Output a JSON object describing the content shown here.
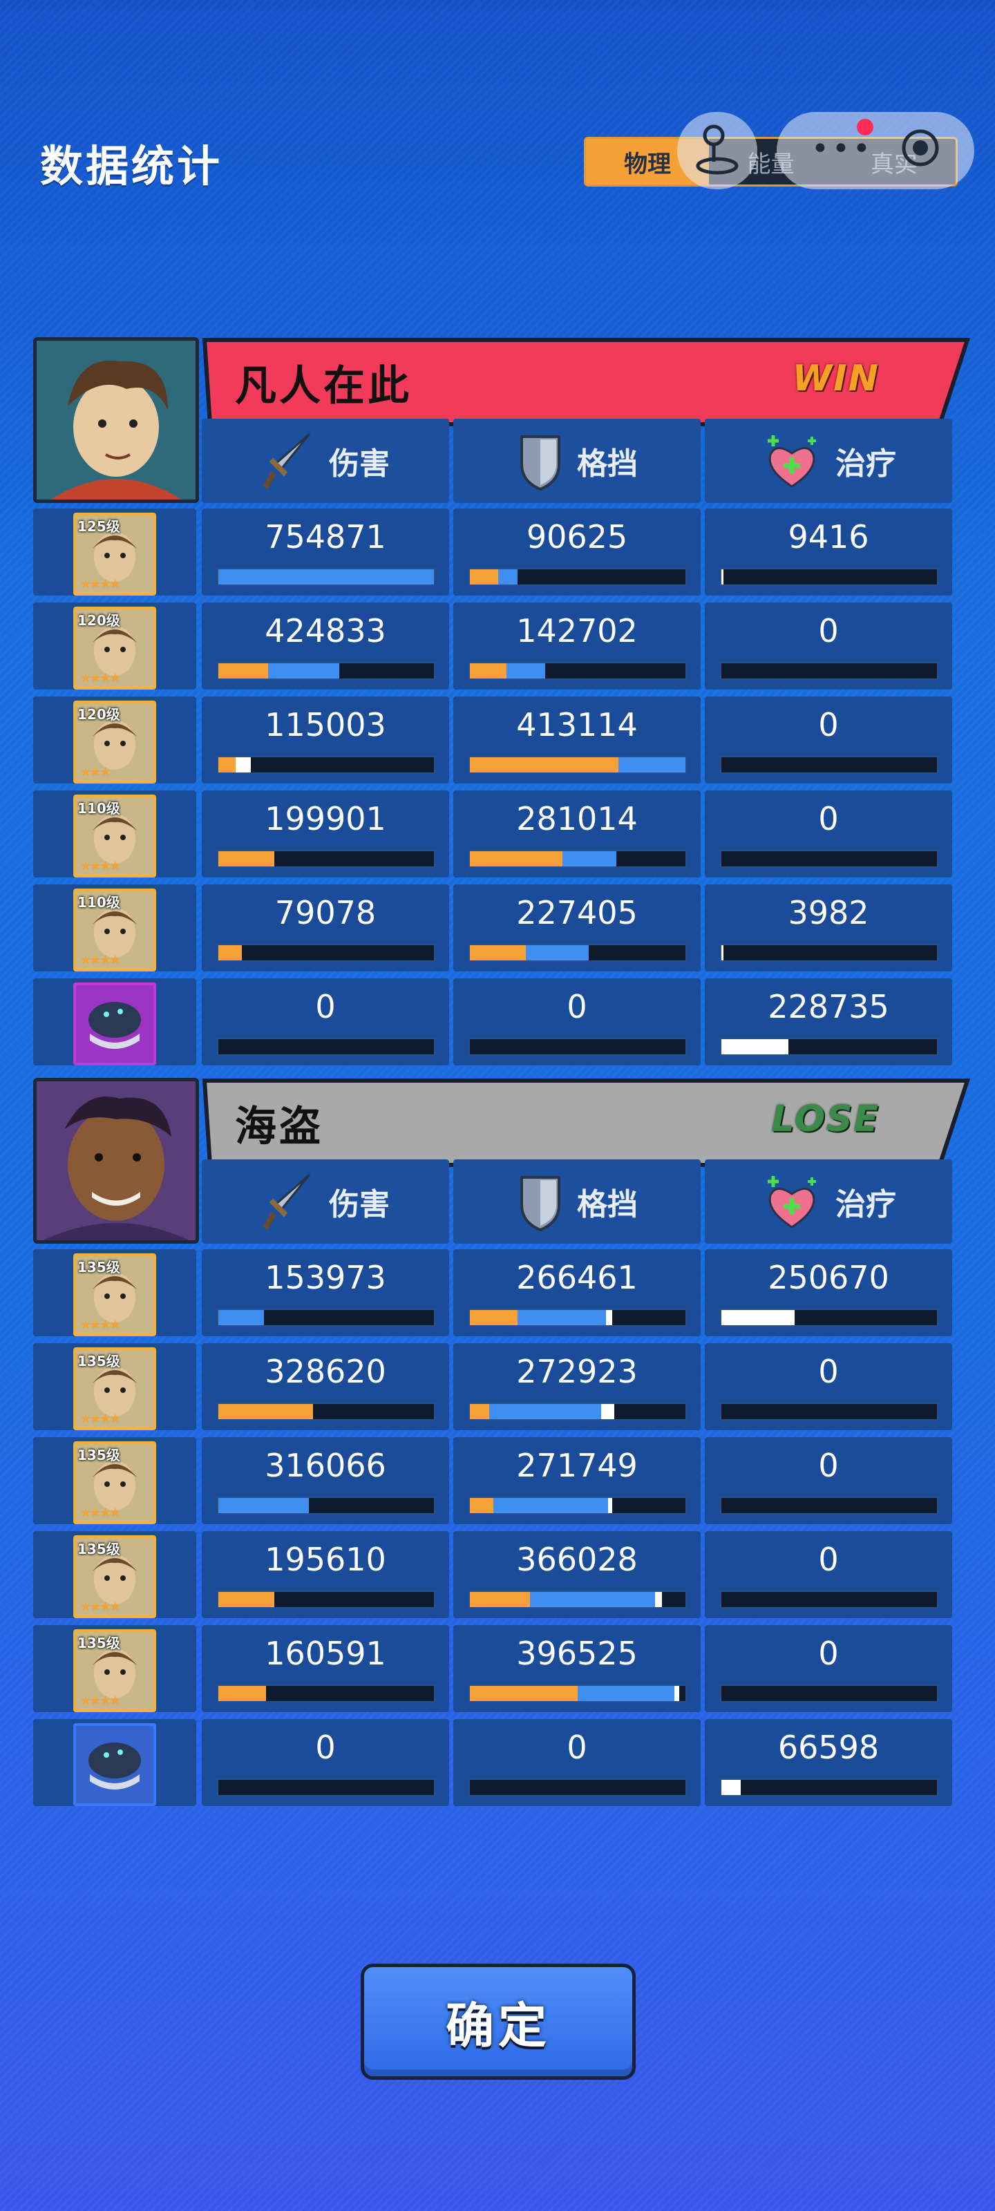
{
  "page": {
    "title": "数据统计",
    "tabs": [
      {
        "label": "物理",
        "active": true
      },
      {
        "label": "能量",
        "active": false
      },
      {
        "label": "真实",
        "active": false
      }
    ],
    "confirm_label": "确定"
  },
  "columns": {
    "damage": "伤害",
    "block": "格挡",
    "heal": "治疗"
  },
  "colors": {
    "win_banner": "#f23a5a",
    "lose_banner": "#a9a9a9",
    "bar_orange": "#f7a236",
    "bar_blue": "#3f8ef2",
    "bar_white": "#ffffff"
  },
  "teams": [
    {
      "name": "凡人在此",
      "result": "WIN",
      "members": [
        {
          "level": "125级",
          "stars": 4,
          "damage": "754871",
          "block": "90625",
          "heal": "9416",
          "damage_bar": [
            0,
            1.0
          ],
          "block_bar": [
            0.13,
            0.09
          ],
          "heal_bar": [
            0,
            0,
            0.01
          ]
        },
        {
          "level": "120级",
          "stars": 4,
          "damage": "424833",
          "block": "142702",
          "heal": "0",
          "damage_bar": [
            0.23,
            0.33
          ],
          "block_bar": [
            0.17,
            0.18
          ],
          "heal_bar": [
            0,
            0,
            0
          ]
        },
        {
          "level": "120级",
          "stars": 3,
          "damage": "115003",
          "block": "413114",
          "heal": "0",
          "damage_bar": [
            0.08,
            0,
            0.07
          ],
          "block_bar": [
            0.69,
            0.31
          ],
          "heal_bar": [
            0,
            0,
            0
          ]
        },
        {
          "level": "110级",
          "stars": 4,
          "damage": "199901",
          "block": "281014",
          "heal": "0",
          "damage_bar": [
            0.26,
            0
          ],
          "block_bar": [
            0.43,
            0.25
          ],
          "heal_bar": [
            0,
            0,
            0
          ]
        },
        {
          "level": "110级",
          "stars": 4,
          "damage": "79078",
          "block": "227405",
          "heal": "3982",
          "damage_bar": [
            0.11,
            0
          ],
          "block_bar": [
            0.26,
            0.29
          ],
          "heal_bar": [
            0,
            0,
            0.01
          ]
        },
        {
          "level": "",
          "stars": 0,
          "summon": true,
          "damage": "0",
          "block": "0",
          "heal": "228735",
          "damage_bar": [
            0,
            0
          ],
          "block_bar": [
            0,
            0
          ],
          "heal_bar": [
            0,
            0,
            0.31
          ]
        }
      ]
    },
    {
      "name": "海盗",
      "result": "LOSE",
      "members": [
        {
          "level": "135级",
          "stars": 4,
          "damage": "153973",
          "block": "266461",
          "heal": "250670",
          "damage_bar": [
            0,
            0.21
          ],
          "block_bar": [
            0.22,
            0.41,
            0.03
          ],
          "heal_bar": [
            0,
            0,
            0.34
          ]
        },
        {
          "level": "135级",
          "stars": 4,
          "damage": "328620",
          "block": "272923",
          "heal": "0",
          "damage_bar": [
            0.44,
            0
          ],
          "block_bar": [
            0.09,
            0.52,
            0.06
          ],
          "heal_bar": [
            0,
            0,
            0
          ]
        },
        {
          "level": "135级",
          "stars": 4,
          "damage": "316066",
          "block": "271749",
          "heal": "0",
          "damage_bar": [
            0,
            0.42
          ],
          "block_bar": [
            0.11,
            0.53,
            0.02
          ],
          "heal_bar": [
            0,
            0,
            0
          ]
        },
        {
          "level": "135级",
          "stars": 4,
          "damage": "195610",
          "block": "366028",
          "heal": "0",
          "damage_bar": [
            0.26,
            0
          ],
          "block_bar": [
            0.28,
            0.58,
            0.03
          ],
          "heal_bar": [
            0,
            0,
            0
          ]
        },
        {
          "level": "135级",
          "stars": 4,
          "damage": "160591",
          "block": "396525",
          "heal": "0",
          "damage_bar": [
            0.22,
            0
          ],
          "block_bar": [
            0.5,
            0.45,
            0.02
          ],
          "heal_bar": [
            0,
            0,
            0
          ]
        },
        {
          "level": "",
          "stars": 0,
          "summon": true,
          "damage": "0",
          "block": "0",
          "heal": "66598",
          "damage_bar": [
            0,
            0
          ],
          "block_bar": [
            0,
            0
          ],
          "heal_bar": [
            0,
            0,
            0.09
          ]
        }
      ]
    }
  ]
}
